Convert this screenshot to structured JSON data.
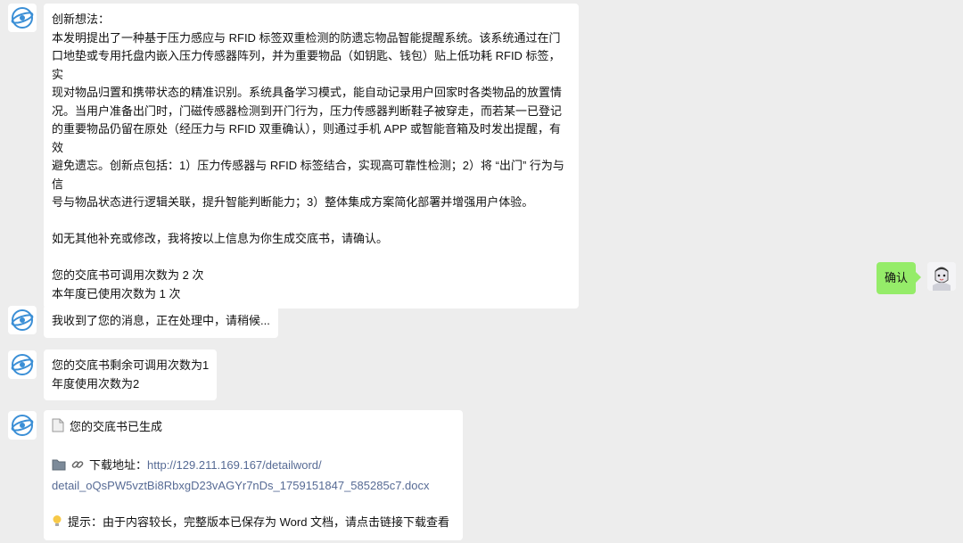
{
  "messages": {
    "m1": {
      "lines": [
        "创新想法：",
        "本发明提出了一种基于压力感应与 RFID 标签双重检测的防遗忘物品智能提醒系统。该系统通过在门",
        "口地垫或专用托盘内嵌入压力传感器阵列，并为重要物品（如钥匙、钱包）贴上低功耗 RFID 标签，实",
        "现对物品归置和携带状态的精准识别。系统具备学习模式，能自动记录用户回家时各类物品的放置情",
        "况。当用户准备出门时，门磁传感器检测到开门行为，压力传感器判断鞋子被穿走，而若某一已登记",
        "的重要物品仍留在原处（经压力与 RFID 双重确认），则通过手机 APP 或智能音箱及时发出提醒，有效",
        "避免遗忘。创新点包括：1）压力传感器与 RFID 标签结合，实现高可靠性检测；2）将 “出门” 行为与信",
        "号与物品状态进行逻辑关联，提升智能判断能力；3）整体集成方案简化部署并增强用户体验。"
      ],
      "confirm": "如无其他补充或修改，我将按以上信息为你生成交底书，请确认。",
      "quota_remaining": "您的交底书可调用次数为 2 次",
      "quota_used": "本年度已使用次数为 1 次"
    },
    "user_confirm": "确认",
    "m2": "我收到了您的消息，正在处理中，请稍候...",
    "m3": {
      "line1": "您的交底书剩余可调用次数为1",
      "line2": "年度使用次数为2"
    },
    "m4": {
      "generated": "您的交底书已生成",
      "download_label": "下载地址：",
      "link_line1": "http://129.211.169.167/detailword/",
      "link_line2": "detail_oQsPW5vztBi8RbxgD23vAGYr7nDs_1759151847_585285c7.docx",
      "tip": "提示：由于内容较长，完整版本已保存为 Word 文档，请点击链接下载查看"
    }
  },
  "colors": {
    "background": "#ededed",
    "user_bubble": "#95ec69",
    "link": "#576b95",
    "bot_logo": "#3b8fd6"
  },
  "icons": [
    "bot-avatar-icon",
    "user-avatar-icon",
    "document-icon",
    "folder-icon",
    "link-icon",
    "lightbulb-icon"
  ]
}
